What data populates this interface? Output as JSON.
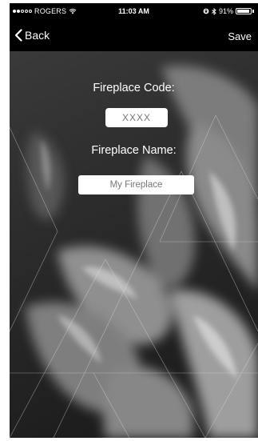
{
  "status_bar": {
    "carrier": "ROGERS",
    "time": "11:03 AM",
    "battery": "91%",
    "battery_level": 0.91,
    "signal_bars": 2
  },
  "nav": {
    "back_label": "Back",
    "save_label": "Save"
  },
  "form": {
    "code_label": "Fireplace Code:",
    "code_placeholder": "XXXX",
    "name_label": "Fireplace Name:",
    "name_placeholder": "My Fireplace"
  }
}
